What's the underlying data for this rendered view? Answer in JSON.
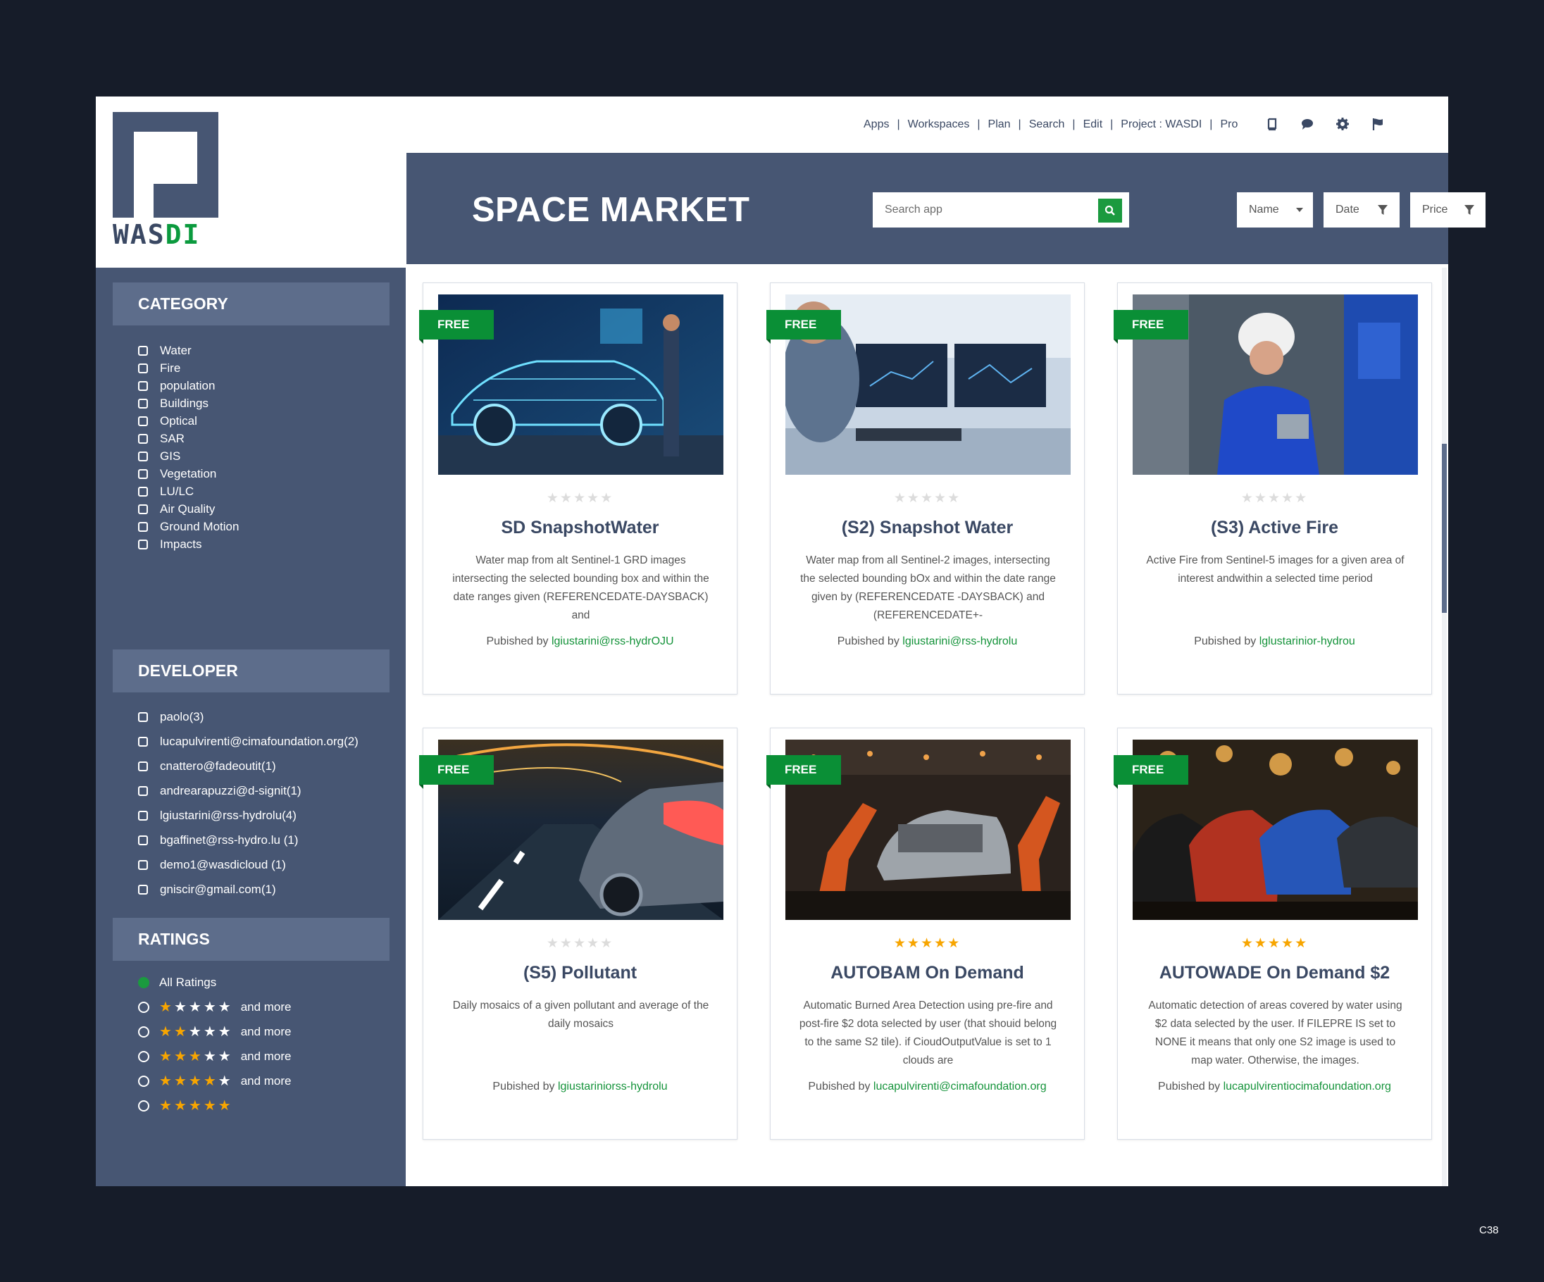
{
  "brand": {
    "logo_text_left": "WAS",
    "logo_text_right": "DI"
  },
  "nav": {
    "items": [
      "Apps",
      "Workspaces",
      "Plan",
      "Search",
      "Edit",
      "Project : WASDI",
      "Pro"
    ],
    "separator": "|",
    "icons": [
      "book-icon",
      "chat-icon",
      "gear-icon",
      "flag-icon"
    ]
  },
  "header": {
    "title": "SPACE MARKET",
    "search_placeholder": "Search app",
    "filters": [
      {
        "label": "Name"
      },
      {
        "label": "Date"
      },
      {
        "label": "Price"
      }
    ]
  },
  "sidebar": {
    "category": {
      "title": "CATEGORY",
      "items": [
        "Water",
        "Fire",
        "population",
        "Buildings",
        "Optical",
        "SAR",
        "GIS",
        "Vegetation",
        "LU/LC",
        "Air Quality",
        "Ground Motion",
        "Impacts"
      ]
    },
    "developer": {
      "title": "DEVELOPER",
      "items": [
        "paolo(3)",
        "lucapulvirenti@cimafoundation.org(2)",
        "cnattero@fadeoutit(1)",
        "andrearapuzzi@d-signit(1)",
        "lgiustarini@rss-hydrolu(4)",
        "bgaffinet@rss-hydro.lu (1)",
        "demo1@wasdicloud (1)",
        "gniscir@gmail.com(1)"
      ]
    },
    "ratings": {
      "title": "RATINGS",
      "all_label": "All Ratings",
      "options": [
        {
          "stars": 1,
          "suffix": "and more"
        },
        {
          "stars": 2,
          "suffix": "and more"
        },
        {
          "stars": 3,
          "suffix": "and more"
        },
        {
          "stars": 4,
          "suffix": "and more"
        },
        {
          "stars": 5,
          "suffix": ""
        }
      ]
    }
  },
  "cards": [
    {
      "badge": "FREE",
      "rating": 0,
      "title": "SD SnapshotWater",
      "description": "Water map from alt Sentinel-1 GRD images intersecting the selected bounding box and within the date ranges given (REFERENCEDATE-DAYSBACK) and",
      "published_prefix": "Pubished by",
      "publisher": "lgiustarini@rss-hydrOJU",
      "image": "car-hologram"
    },
    {
      "badge": "FREE",
      "rating": 0,
      "title": "(S2) Snapshot Water",
      "description": "Water map from all Sentinel-2 images, intersecting the selected bounding bOx and within the date range given by (REFERENCEDATE -DAYSBACK) and (REFERENCEDATE+-",
      "published_prefix": "Pubished by",
      "publisher": "lgiustarini@rss-hydrolu",
      "image": "monitor-screens"
    },
    {
      "badge": "FREE",
      "rating": 0,
      "title": "(S3) Active Fire",
      "description": "Active Fire from Sentinel-5 images for a given area of interest andwithin a selected time period",
      "published_prefix": "Pubished by",
      "publisher": "lglustarinior-hydrou",
      "image": "factory-worker"
    },
    {
      "badge": "FREE",
      "rating": 0,
      "title": "(S5) Pollutant",
      "description": "Daily mosaics of a given pollutant and average of the daily mosaics",
      "published_prefix": "Pubished by",
      "publisher": "lgiustariniorss-hydrolu",
      "image": "car-tunnel"
    },
    {
      "badge": "FREE",
      "rating": 5,
      "title": "AUTOBAM On Demand",
      "description": "Automatic Burned Area Detection using pre-fire and post-fire $2 dota selected by user (that shouid belong to the same S2 tile). if CioudOutputValue is set to 1 clouds are",
      "published_prefix": "Pubished by",
      "publisher": "lucapulvirenti@cimafoundation.org",
      "image": "robot-assembly"
    },
    {
      "badge": "FREE",
      "rating": 5,
      "title": "AUTOWADE On Demand $2",
      "description": "Automatic detection of areas covered by water using $2 data selected by the user. If FILEPRE IS set to NONE it means that only one S2 image is used to map water. Otherwise, the images.",
      "published_prefix": "Pubished by",
      "publisher": "lucapulvirentiocimafoundation.org",
      "image": "cars-row"
    }
  ],
  "corner_label": "C38",
  "colors": {
    "brand_dark": "#475673",
    "section_head": "#5d6d8b",
    "accent_green": "#0a8f36",
    "star": "#f7a500",
    "page_bg": "#161c29"
  }
}
